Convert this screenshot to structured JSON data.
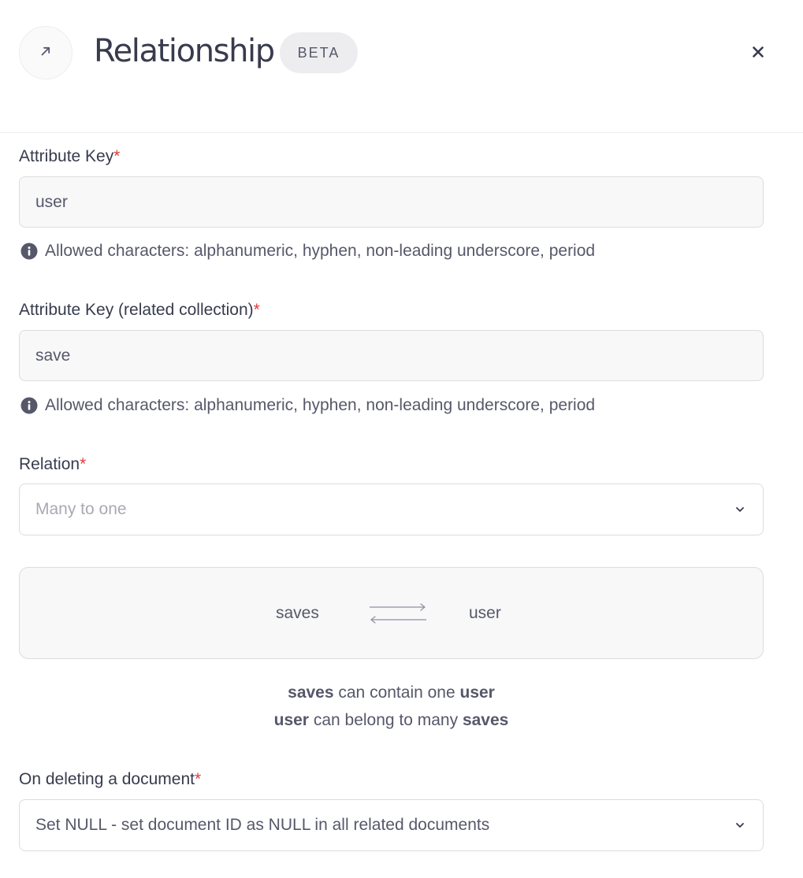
{
  "header": {
    "icon": "arrow-up-right-icon",
    "title": "Relationship",
    "badge": "BETA",
    "close_icon": "close-icon"
  },
  "attribute_key": {
    "label": "Attribute Key",
    "required_mark": "*",
    "value": "user",
    "hint": "Allowed characters: alphanumeric, hyphen, non-leading underscore, period"
  },
  "related_key": {
    "label": "Attribute Key (related collection)",
    "required_mark": "*",
    "value": "save",
    "hint": "Allowed characters: alphanumeric, hyphen, non-leading underscore, period"
  },
  "relation": {
    "label": "Relation",
    "required_mark": "*",
    "selected": "Many to one"
  },
  "diagram": {
    "left": "saves",
    "right": "user",
    "icon": "bidirectional-arrows-icon"
  },
  "description": {
    "line1": {
      "subject": "saves",
      "text": " can contain one ",
      "object": "user"
    },
    "line2": {
      "subject": "user",
      "text": " can belong to many ",
      "object": "saves"
    }
  },
  "on_delete": {
    "label": "On deleting a document",
    "required_mark": "*",
    "selected": "Set NULL - set document ID as NULL in all related documents"
  },
  "colors": {
    "required": "#e23b3b",
    "text": "#373b4d",
    "muted": "#56586a",
    "field_bg": "#f8f8f9",
    "border": "#dcdce2"
  }
}
